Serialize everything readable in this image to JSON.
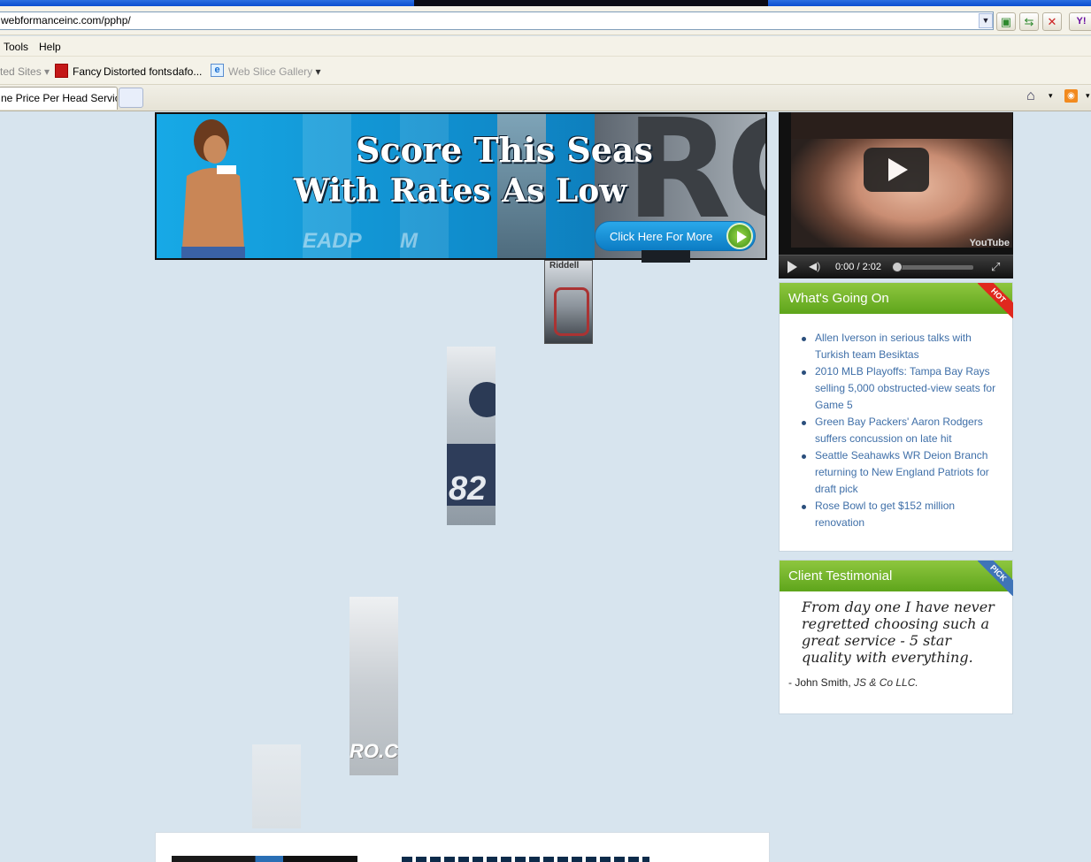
{
  "browser": {
    "address_url": "webformanceinc.com/pphp/",
    "menu": {
      "tools": "Tools",
      "help": "Help"
    },
    "favorites": {
      "suggested_sites": "ted Sites",
      "fancy": "Fancy",
      "distorted_fonts": "Distorted fonts",
      "dafont": "dafo...",
      "web_slice_gallery": "Web Slice Gallery"
    },
    "tab_title": "ne Price Per Head Services"
  },
  "banner": {
    "line1": "Score This Seas",
    "line2": "With Rates As Low",
    "big_letters": "RO",
    "button_label": "Click Here For More",
    "strip_text_1": "EADP",
    "strip_text_2": "M",
    "fragment_text": "RO.CO"
  },
  "video": {
    "time": "0:00 / 2:02",
    "brand": "YouTube"
  },
  "news": {
    "title": "What's Going On",
    "ribbon": "HOT",
    "items": [
      "Allen Iverson in serious talks with Turkish team Besiktas",
      "2010 MLB Playoffs: Tampa Bay Rays selling 5,000 obstructed-view seats for Game 5",
      "Green Bay Packers' Aaron Rodgers suffers concussion on late hit",
      "Seattle Seahawks WR Deion Branch returning to New England Patriots for draft pick",
      "Rose Bowl to get $152 million renovation"
    ]
  },
  "testimonial": {
    "title": "Client Testimonial",
    "ribbon": "PICK",
    "quote": "From day one I have never regretted choosing such a great service - 5 star quality with everything.",
    "author_name": "- John Smith, ",
    "author_company": "JS & Co LLC."
  },
  "colors": {
    "accent_green": "#6aae22",
    "link_blue": "#3f6fa8",
    "hot_red": "#e0281e",
    "pick_blue": "#3f74b8"
  }
}
